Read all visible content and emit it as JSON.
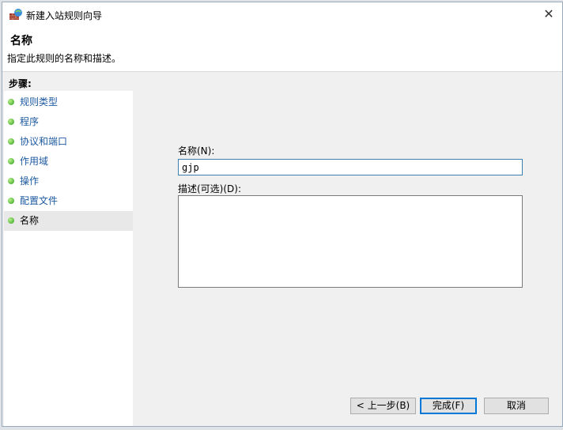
{
  "window": {
    "title": "新建入站规则向导",
    "close": "✕"
  },
  "header": {
    "title": "名称",
    "subtitle": "指定此规则的名称和描述。"
  },
  "steps": {
    "heading": "步骤:",
    "items": [
      {
        "label": "规则类型"
      },
      {
        "label": "程序"
      },
      {
        "label": "协议和端口"
      },
      {
        "label": "作用域"
      },
      {
        "label": "操作"
      },
      {
        "label": "配置文件"
      },
      {
        "label": "名称"
      }
    ]
  },
  "form": {
    "name_label": "名称(N):",
    "name_value": "gjp",
    "desc_label": "描述(可选)(D):",
    "desc_value": ""
  },
  "buttons": {
    "back": "< 上一步(B)",
    "finish": "完成(F)",
    "cancel": "取消"
  }
}
